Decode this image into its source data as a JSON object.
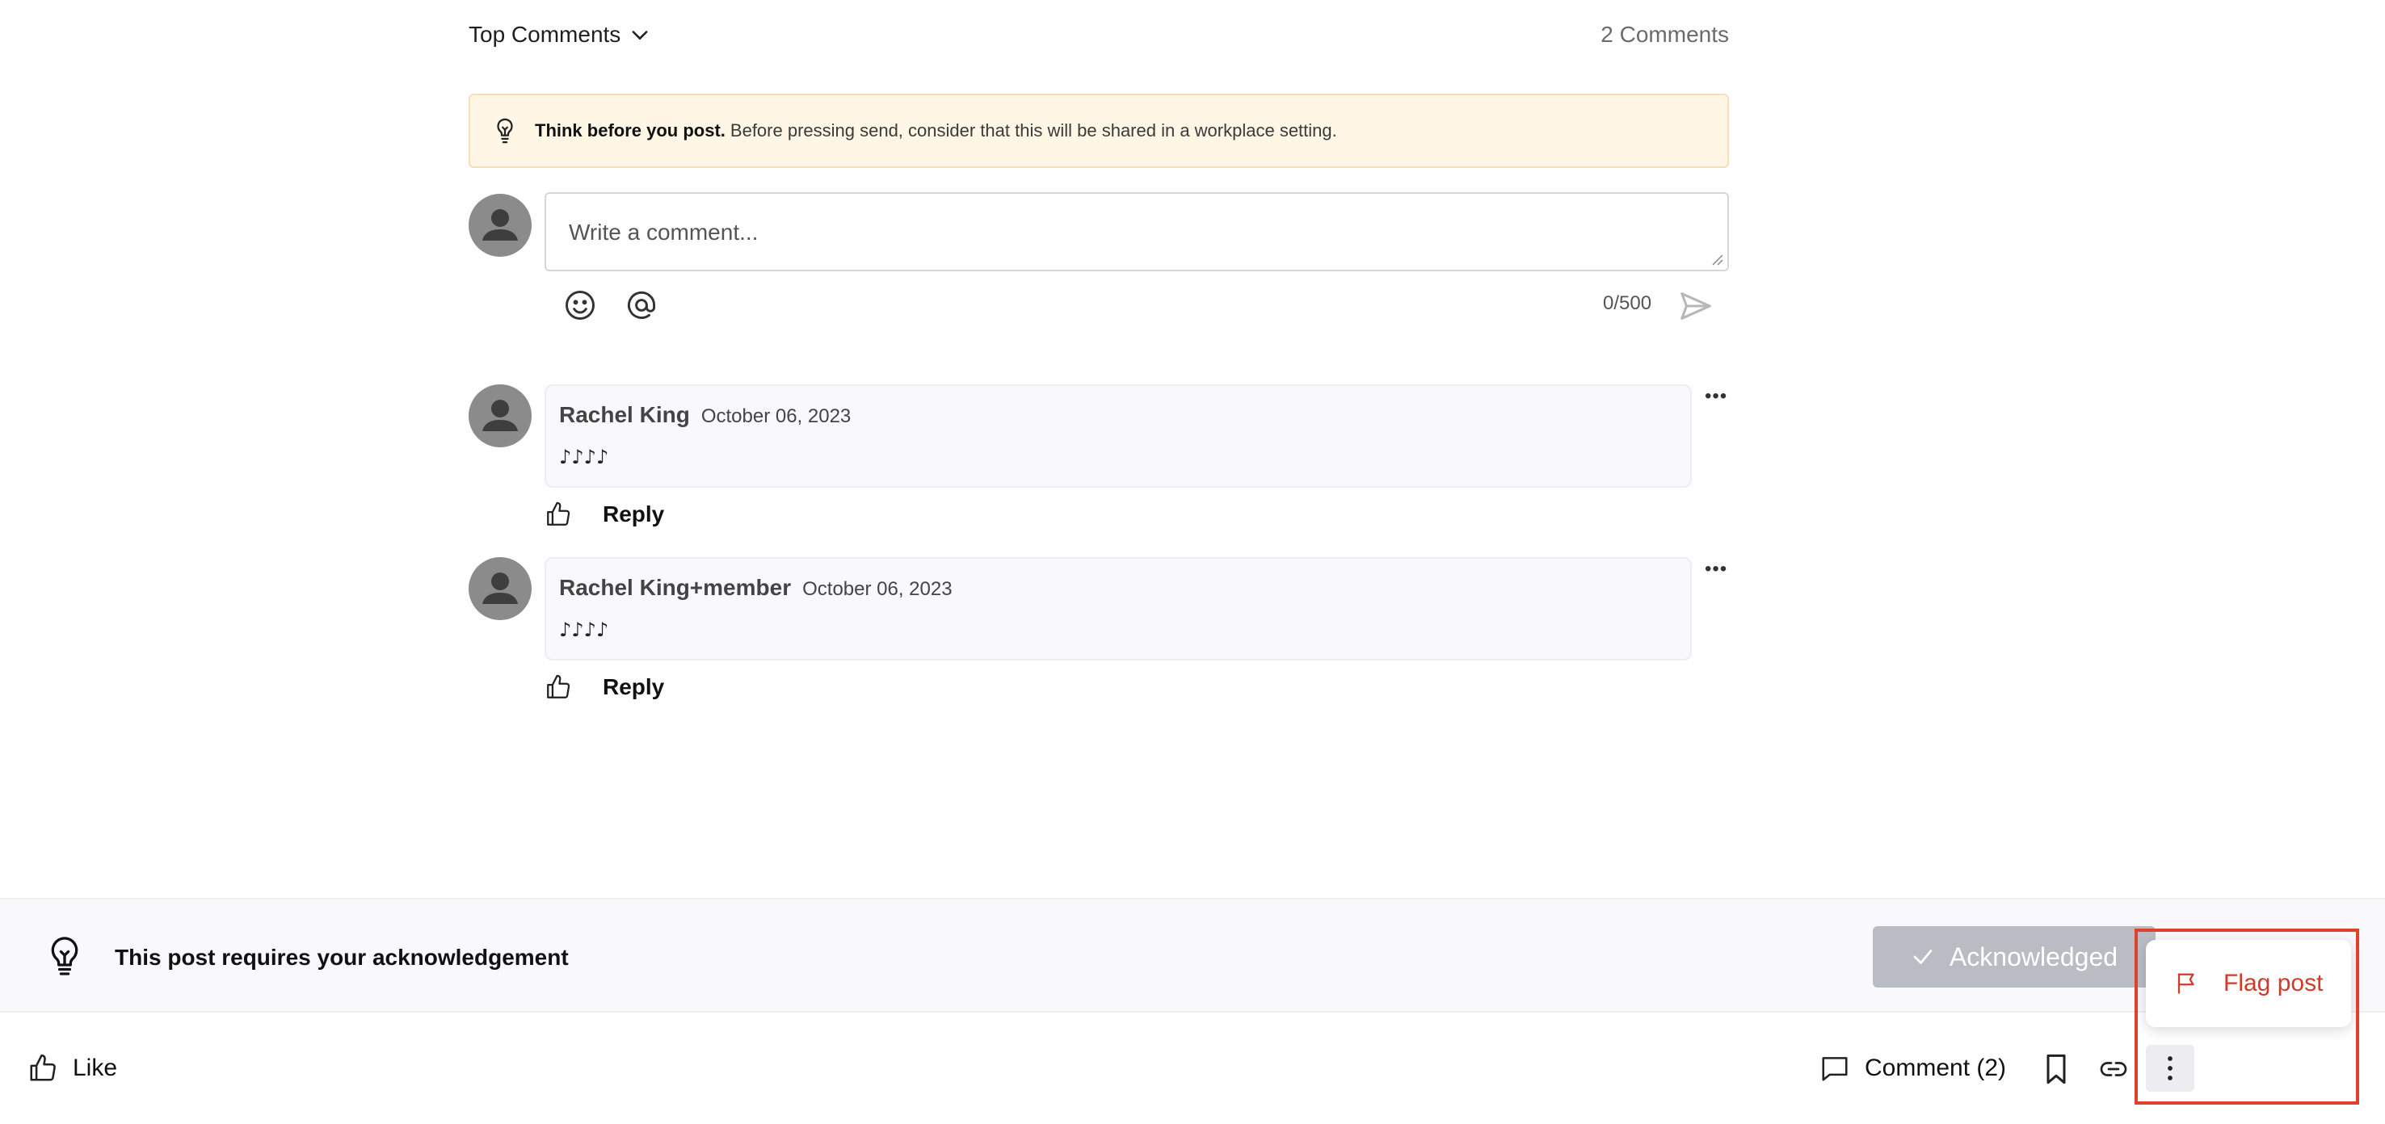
{
  "comments_header": {
    "sort_label": "Top Comments",
    "count_label": "2 Comments"
  },
  "banner": {
    "bold": "Think before you post.",
    "text": "Before pressing send, consider that this will be shared in a workplace setting."
  },
  "composer": {
    "placeholder": "Write a comment...",
    "char_count": "0/500"
  },
  "comments": [
    {
      "author": "Rachel King",
      "date": "October 06, 2023",
      "body": "♪♪♪♪",
      "reply_label": "Reply"
    },
    {
      "author": "Rachel King+member",
      "date": "October 06, 2023",
      "body": "♪♪♪♪",
      "reply_label": "Reply"
    }
  ],
  "acknowledgement": {
    "text": "This post requires your acknowledgement",
    "button_label": "Acknowledged"
  },
  "bottom_bar": {
    "like_label": "Like",
    "comment_label": "Comment (2)"
  },
  "menu": {
    "flag_label": "Flag post"
  },
  "colors": {
    "banner_bg": "#fff6e6",
    "ack_button": "#b9bcc3",
    "flag_text": "#d13b2a",
    "highlight_box": "#e0412c"
  }
}
